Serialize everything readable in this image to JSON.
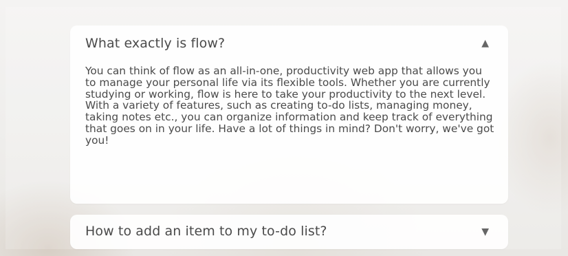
{
  "faq": [
    {
      "question": "What exactly is flow?",
      "answer": "You can think of flow as an all-in-one, productivity web app that allows you to manage your personal life via its flexible tools. Whether you are currently studying or working, flow is here to take your productivity to the next level. With a variety of features, such as creating to-do lists, managing money, taking notes etc., you can organize information and keep track of everything that goes on in your life. Have a lot of things in mind? Don't worry, we've got you!",
      "toggle_icon": "▲",
      "expanded": true
    },
    {
      "question": "How to add an item to my to-do list?",
      "toggle_icon": "▼",
      "expanded": false
    }
  ]
}
